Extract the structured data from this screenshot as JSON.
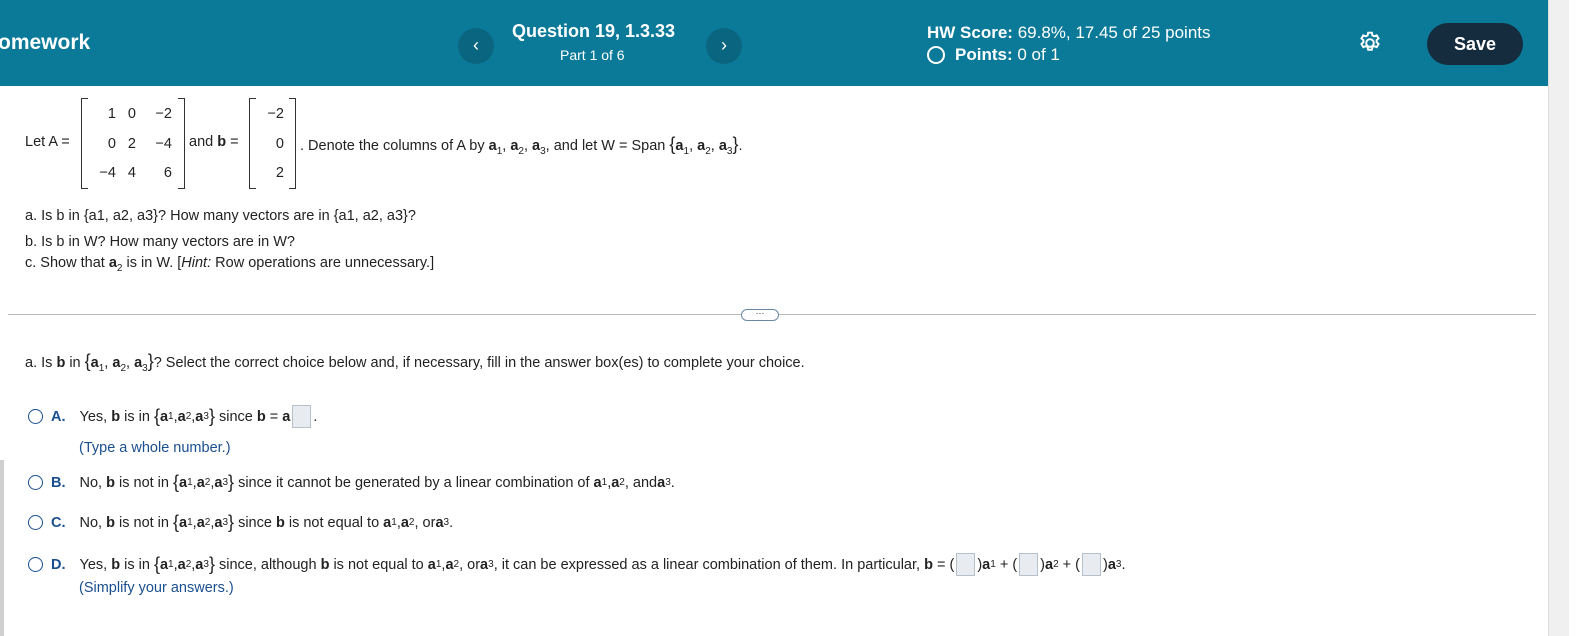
{
  "header": {
    "brand": "omework",
    "prev_icon": "‹",
    "next_icon": "›",
    "question_title": "Question 19, 1.3.33",
    "question_part": "Part 1 of 6",
    "score_label": "HW Score:",
    "score_value": " 69.8%, 17.45 of 25 points",
    "points_label": "Points:",
    "points_value": " 0 of 1",
    "save_label": "Save"
  },
  "problem": {
    "let_a": "Let A =",
    "matrix_a": [
      [
        "1",
        "0",
        "−2"
      ],
      [
        "0",
        "2",
        "−4"
      ],
      [
        "−4",
        "4",
        "6"
      ]
    ],
    "and_b": "and",
    "b_label": "b",
    "equals": "=",
    "vector_b": [
      "−2",
      "0",
      "2"
    ],
    "denote_text": ". Denote the columns of A by",
    "w_text": ", and let W = Span",
    "part_a": "a. Is b in {a1, a2, a3}? How many vectors are in {a1, a2, a3}?",
    "part_b": "b. Is b in W? How many vectors are in W?",
    "part_c_pre": "c. Show that",
    "part_c_post": "is in W. [",
    "hint_word": "Hint:",
    "hint_text": " Row operations are unnecessary.]"
  },
  "question": {
    "prompt_pre": "a. Is",
    "prompt_post": "? Select the correct choice below and, if necessary, fill in the answer box(es) to complete your choice."
  },
  "choices": {
    "a_letter": "A.",
    "a_pre": "Yes,",
    "a_mid": "is in",
    "a_since": "since",
    "a_hint": "(Type a whole number.)",
    "b_letter": "B.",
    "b_pre": "No,",
    "b_mid": "is not in",
    "b_text": "since it cannot be generated by a linear combination of",
    "c_letter": "C.",
    "c_pre": "No,",
    "c_mid": "is not in",
    "c_text": "since",
    "c_text2": "is not equal to",
    "d_letter": "D.",
    "d_pre": "Yes,",
    "d_mid": "is in",
    "d_text": "since, although",
    "d_text2": "is not equal to",
    "d_text3": ", it can be expressed as a linear combination of them. In particular,",
    "d_hint": "(Simplify your answers.)"
  },
  "colors": {
    "header_bg": "#0b7a99",
    "save_bg": "#142c3d",
    "choice_blue": "#1a4f8f"
  }
}
